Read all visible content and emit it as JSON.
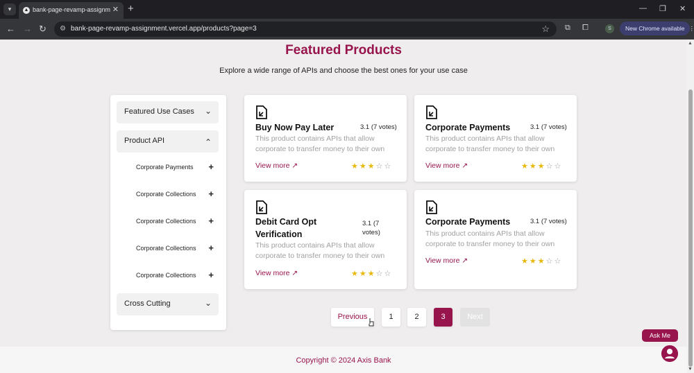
{
  "browser": {
    "tab_title": "bank-page-revamp-assignment",
    "url": "bank-page-revamp-assignment.vercel.app/products?page=3",
    "chrome_update": "New Chrome available",
    "profile_initial": "S"
  },
  "page": {
    "title": "Featured Products",
    "subtitle": "Explore a wide range of APIs and choose the best ones for your use case"
  },
  "sidebar": {
    "sections": [
      {
        "label": "Featured Use Cases",
        "expanded": false
      },
      {
        "label": "Product API",
        "expanded": true
      },
      {
        "label": "Cross Cutting",
        "expanded": false
      }
    ],
    "product_api_items": [
      "Corporate Payments",
      "Corporate Collections",
      "Corporate Collections",
      "Corporate Collections",
      "Corporate Collections"
    ]
  },
  "products": [
    {
      "title": "Buy Now Pay Later",
      "rating": "3.1 (7 votes)",
      "description": "This product contains APIs that allow corporate to transfer money to their own accounts",
      "link": "View more",
      "stars": 3
    },
    {
      "title": "Corporate Payments",
      "rating": "3.1 (7 votes)",
      "description": "This product contains APIs that allow corporate to transfer money to their own accounts",
      "link": "View more",
      "stars": 3
    },
    {
      "title": "Debit Card Opt Verification",
      "rating": "3.1 (7 votes)",
      "description": "This product contains APIs that allow corporate to transfer money to their own accounts",
      "link": "View more",
      "stars": 3
    },
    {
      "title": "Corporate Payments",
      "rating": "3.1 (7 votes)",
      "description": "This product contains APIs that allow corporate to transfer money to their own accounts",
      "link": "View more",
      "stars": 3
    }
  ],
  "pagination": {
    "previous": "Previous",
    "pages": [
      "1",
      "2",
      "3"
    ],
    "current": "3",
    "next": "Next"
  },
  "footer": {
    "copyright": "Copyright © 2024 Axis Bank"
  },
  "chat": {
    "label": "Ask Me"
  },
  "colors": {
    "brand": "#97144d",
    "star_filled": "#e8b90c"
  }
}
